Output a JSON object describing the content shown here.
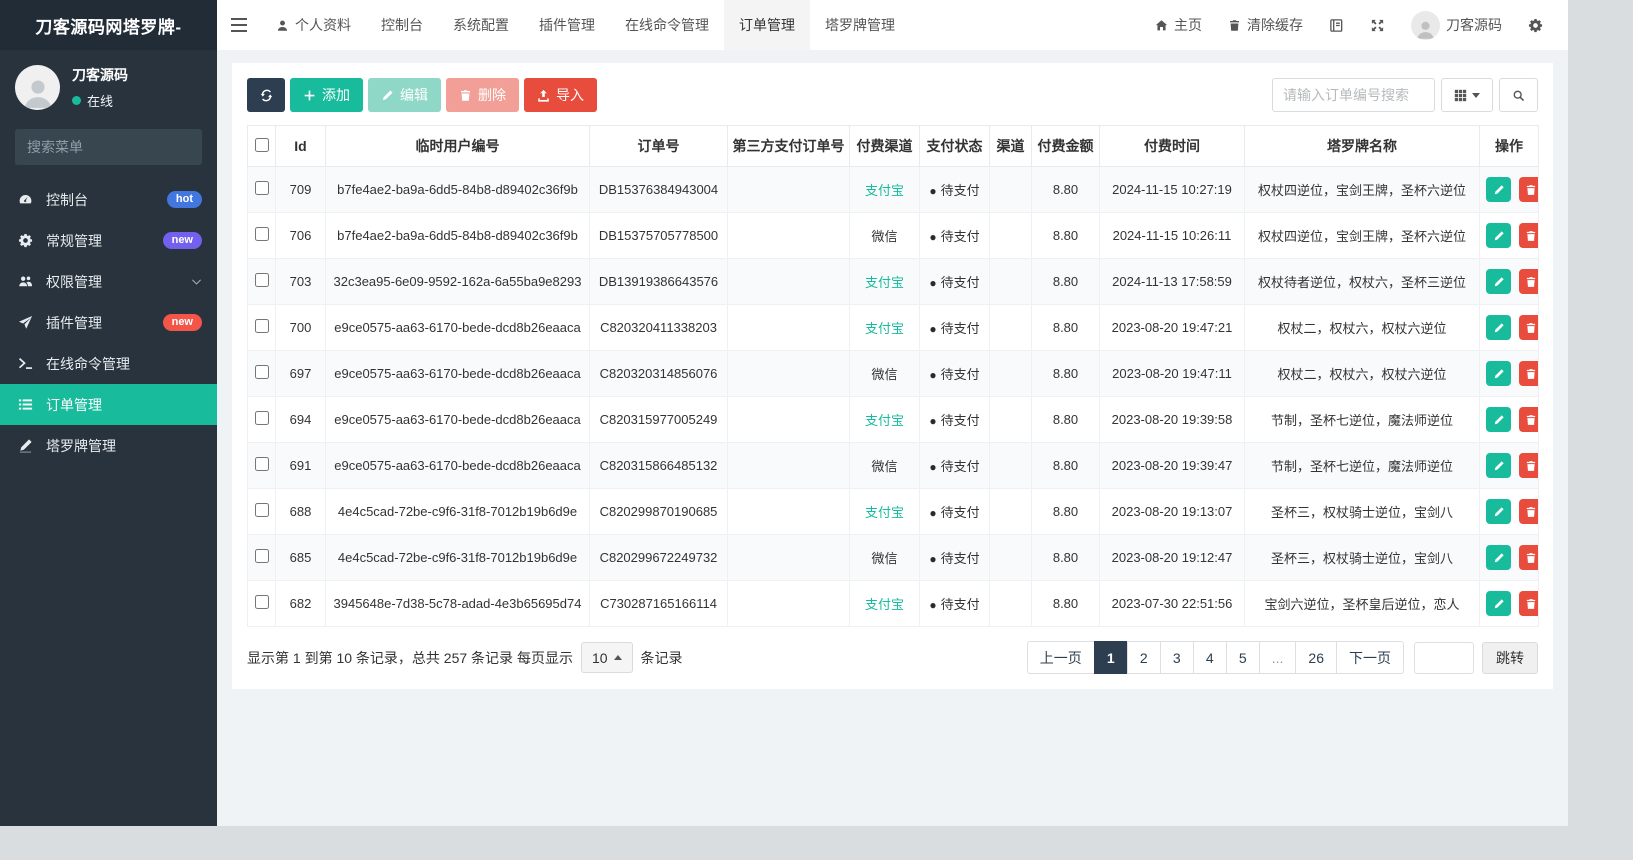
{
  "sidebar": {
    "brand": "刀客源码网塔罗牌-",
    "user": {
      "name": "刀客源码",
      "status": "在线"
    },
    "search_placeholder": "搜索菜单",
    "items": [
      {
        "label": "控制台",
        "icon": "dashboard-icon",
        "badge": "hot",
        "badge_color": "#4277e0"
      },
      {
        "label": "常规管理",
        "icon": "cogs-icon",
        "badge": "new",
        "badge_color": "#7460ee"
      },
      {
        "label": "权限管理",
        "icon": "users-icon",
        "has_submenu": true
      },
      {
        "label": "插件管理",
        "icon": "rocket-icon",
        "badge": "new",
        "badge_color": "#f35549"
      },
      {
        "label": "在线命令管理",
        "icon": "terminal-icon"
      },
      {
        "label": "订单管理",
        "icon": "list-icon",
        "active": true
      },
      {
        "label": "塔罗牌管理",
        "icon": "pen-icon"
      }
    ]
  },
  "topbar": {
    "menu": [
      {
        "label": "个人资料",
        "icon": "user-icon"
      },
      {
        "label": "控制台"
      },
      {
        "label": "系统配置"
      },
      {
        "label": "插件管理"
      },
      {
        "label": "在线命令管理"
      },
      {
        "label": "订单管理",
        "active": true
      },
      {
        "label": "塔罗牌管理"
      }
    ],
    "right": {
      "home_label": "主页",
      "clear_cache_label": "清除缓存",
      "username": "刀客源码"
    }
  },
  "toolbar": {
    "add_label": "添加",
    "edit_label": "编辑",
    "delete_label": "删除",
    "import_label": "导入",
    "search_placeholder": "请输入订单编号搜索"
  },
  "table": {
    "columns": [
      "Id",
      "临时用户编号",
      "订单号",
      "第三方支付订单号",
      "付费渠道",
      "支付状态",
      "渠道",
      "付费金额",
      "付费时间",
      "塔罗牌名称",
      "操作"
    ],
    "rows": [
      {
        "id": "709",
        "user_no": "b7fe4ae2-ba9a-6dd5-84b8-d89402c36f9b",
        "order_no": "DB15376384943004",
        "third_no": "",
        "channel": "支付宝",
        "status": "待支付",
        "qudao": "",
        "amount": "8.80",
        "time": "2024-11-15 10:27:19",
        "tarot": "权杖四逆位，宝剑王牌，圣杯六逆位"
      },
      {
        "id": "706",
        "user_no": "b7fe4ae2-ba9a-6dd5-84b8-d89402c36f9b",
        "order_no": "DB15375705778500",
        "third_no": "",
        "channel": "微信",
        "status": "待支付",
        "qudao": "",
        "amount": "8.80",
        "time": "2024-11-15 10:26:11",
        "tarot": "权杖四逆位，宝剑王牌，圣杯六逆位"
      },
      {
        "id": "703",
        "user_no": "32c3ea95-6e09-9592-162a-6a55ba9e8293",
        "order_no": "DB13919386643576",
        "third_no": "",
        "channel": "支付宝",
        "status": "待支付",
        "qudao": "",
        "amount": "8.80",
        "time": "2024-11-13 17:58:59",
        "tarot": "权杖待者逆位，权杖六，圣杯三逆位"
      },
      {
        "id": "700",
        "user_no": "e9ce0575-aa63-6170-bede-dcd8b26eaaca",
        "order_no": "C820320411338203",
        "third_no": "",
        "channel": "支付宝",
        "status": "待支付",
        "qudao": "",
        "amount": "8.80",
        "time": "2023-08-20 19:47:21",
        "tarot": "权杖二，权杖六，权杖六逆位"
      },
      {
        "id": "697",
        "user_no": "e9ce0575-aa63-6170-bede-dcd8b26eaaca",
        "order_no": "C820320314856076",
        "third_no": "",
        "channel": "微信",
        "status": "待支付",
        "qudao": "",
        "amount": "8.80",
        "time": "2023-08-20 19:47:11",
        "tarot": "权杖二，权杖六，权杖六逆位"
      },
      {
        "id": "694",
        "user_no": "e9ce0575-aa63-6170-bede-dcd8b26eaaca",
        "order_no": "C820315977005249",
        "third_no": "",
        "channel": "支付宝",
        "status": "待支付",
        "qudao": "",
        "amount": "8.80",
        "time": "2023-08-20 19:39:58",
        "tarot": "节制，圣杯七逆位，魔法师逆位"
      },
      {
        "id": "691",
        "user_no": "e9ce0575-aa63-6170-bede-dcd8b26eaaca",
        "order_no": "C820315866485132",
        "third_no": "",
        "channel": "微信",
        "status": "待支付",
        "qudao": "",
        "amount": "8.80",
        "time": "2023-08-20 19:39:47",
        "tarot": "节制，圣杯七逆位，魔法师逆位"
      },
      {
        "id": "688",
        "user_no": "4e4c5cad-72be-c9f6-31f8-7012b19b6d9e",
        "order_no": "C820299870190685",
        "third_no": "",
        "channel": "支付宝",
        "status": "待支付",
        "qudao": "",
        "amount": "8.80",
        "time": "2023-08-20 19:13:07",
        "tarot": "圣杯三，权杖骑士逆位，宝剑八"
      },
      {
        "id": "685",
        "user_no": "4e4c5cad-72be-c9f6-31f8-7012b19b6d9e",
        "order_no": "C820299672249732",
        "third_no": "",
        "channel": "微信",
        "status": "待支付",
        "qudao": "",
        "amount": "8.80",
        "time": "2023-08-20 19:12:47",
        "tarot": "圣杯三，权杖骑士逆位，宝剑八"
      },
      {
        "id": "682",
        "user_no": "3945648e-7d38-5c78-adad-4e3b65695d74",
        "order_no": "C730287165166114",
        "third_no": "",
        "channel": "支付宝",
        "status": "待支付",
        "qudao": "",
        "amount": "8.80",
        "time": "2023-07-30 22:51:56",
        "tarot": "宝剑六逆位，圣杯皇后逆位，恋人"
      }
    ]
  },
  "pagination": {
    "info_prefix": "显示第 1 到第 10 条记录，总共 257 条记录 每页显示",
    "page_size": "10",
    "info_suffix": "条记录",
    "prev_label": "上一页",
    "next_label": "下一页",
    "pages": [
      "1",
      "2",
      "3",
      "4",
      "5",
      "...",
      "26"
    ],
    "active_page": "1",
    "jump_label": "跳转"
  },
  "colors": {
    "sidebar_bg": "#28333e",
    "sidebar_header_bg": "#222c37",
    "accent_teal": "#18bc9c",
    "badge_hot_blue": "#4277e0",
    "badge_new_purple": "#7460ee",
    "badge_new_red": "#f35549",
    "btn_refresh_navy": "#2c3e50",
    "btn_import_red": "#e74c3c",
    "alipay_text": "#18bc9c",
    "pager_active_navy": "#2c3e50",
    "content_bg": "#f0f3f5"
  }
}
